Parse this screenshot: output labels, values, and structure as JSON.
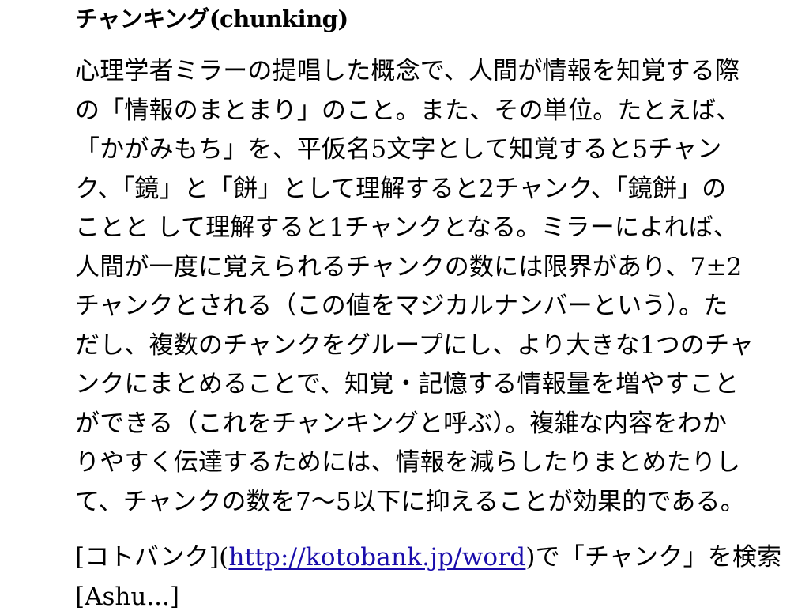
{
  "article": {
    "heading": "チャンキング(chunking)",
    "lines": [
      "心理学者ミラーの提唱した概念で、人間が情報を知覚する際",
      "の「情報のまとまり」のこと。また、その単位。たとえば、",
      "「かがみもち」を、平仮名5文字として知覚すると5チャン",
      "ク、「鏡」と「餅」として理解すると2チャンク、「鏡餅」の",
      "ことと して理解すると1チャンクとなる。ミラーによれば、",
      "人間が一度に覚えられるチャンクの数には限界があり、7±2",
      "チャンクとされる（この値をマジカルナンバーという）。た",
      "だし、複数のチャンクをグループにし、より大きな1つのチャ",
      "ンクにまとめることで、知覚・記憶する情報量を増やすこと",
      "ができる（これをチャンキングと呼ぶ）。複雑な内容をわか",
      "りやすく伝達するためには、情報を減らしたりまとめたりし",
      "て、チャンクの数を7〜5以下に抑えることが効果的である。"
    ],
    "source_prefix": "[コトバンク](",
    "source_url": "http://kotobank.jp/word",
    "source_suffix": ")で「チャンク」を検索",
    "next_line_partial": "[Ashu...]"
  }
}
